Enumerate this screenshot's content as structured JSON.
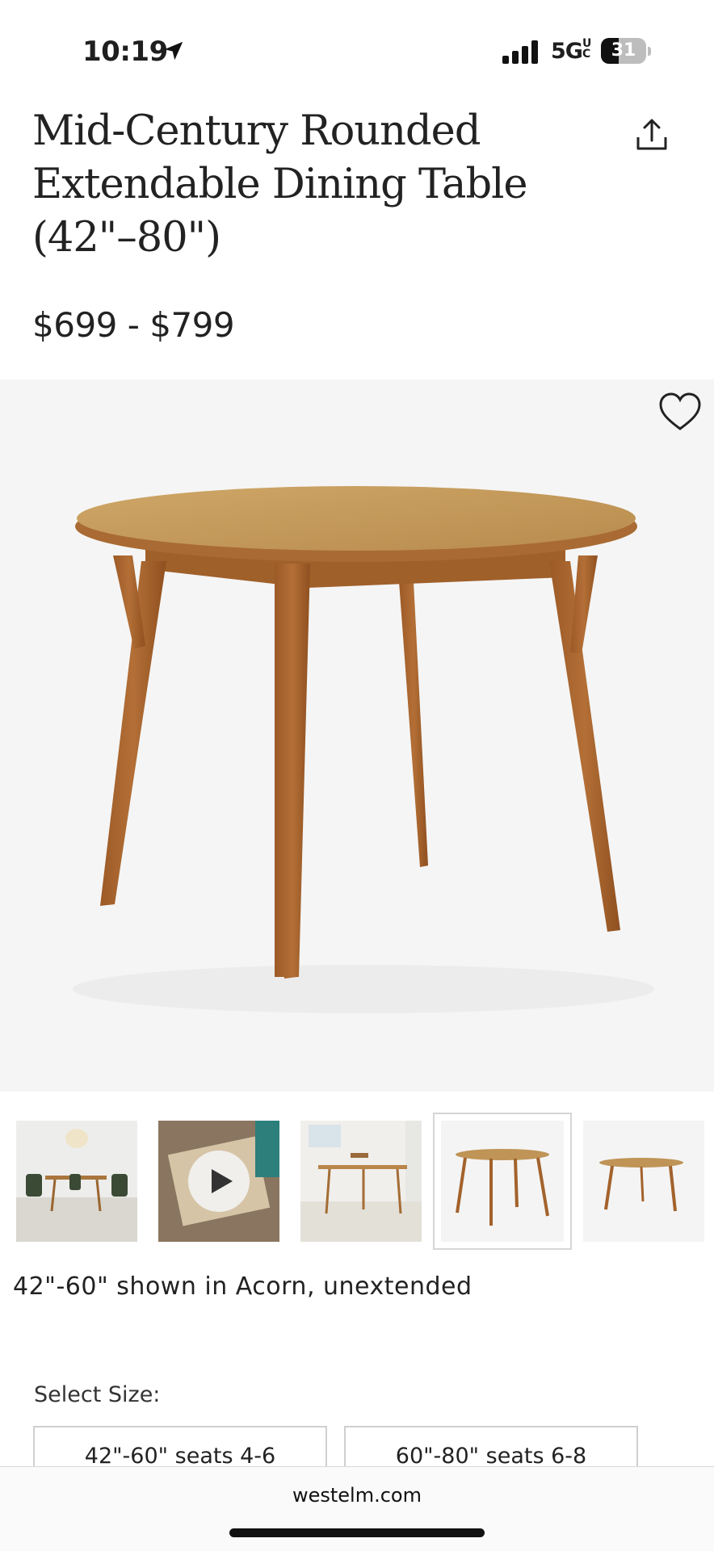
{
  "status_bar": {
    "time": "10:19",
    "network": "5G",
    "network_suffix": "UC",
    "battery": "31"
  },
  "product": {
    "title": "Mid-Century Rounded Extendable Dining Table (42\"–80\")",
    "price": "$699 - $799",
    "image_caption": "42\"-60\" shown in Acorn, unextended"
  },
  "gallery": {
    "thumbnails": [
      {
        "kind": "room scene"
      },
      {
        "kind": "video"
      },
      {
        "kind": "room scene"
      },
      {
        "kind": "product",
        "selected": true
      },
      {
        "kind": "product"
      }
    ]
  },
  "size": {
    "label": "Select Size:",
    "options": [
      "42\"-60\" seats 4-6",
      "60\"-80\" seats 6-8"
    ]
  },
  "browser": {
    "url": "westelm.com"
  },
  "colors": {
    "wood_top": "#c59b5d",
    "wood_leg": "#a8652e",
    "hero_bg": "#f5f5f5"
  }
}
